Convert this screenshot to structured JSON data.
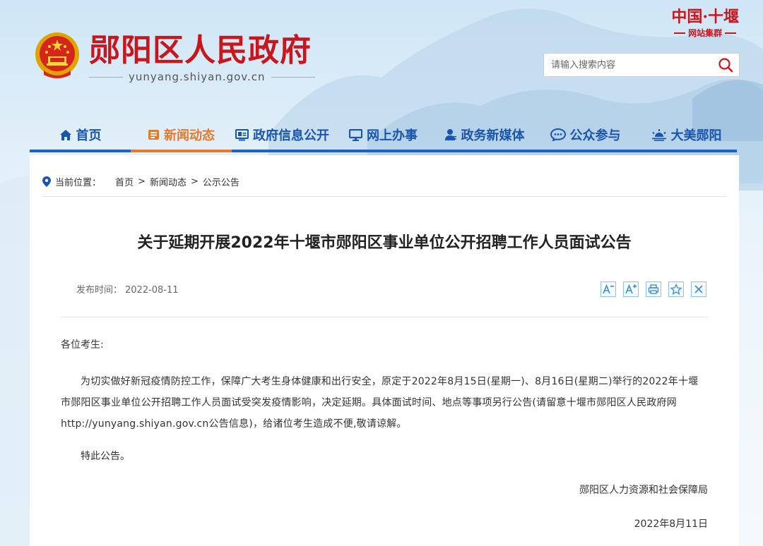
{
  "header": {
    "site_title": "郧阳区人民政府",
    "site_domain": "yunyang.shiyan.gov.cn",
    "group_logo_main": "中国·十堰",
    "group_logo_sub": "网站集群",
    "search_placeholder": "请输入搜索内容",
    "emblem_icon": "national-emblem-icon"
  },
  "nav": {
    "items": [
      {
        "label": "首页",
        "icon": "home-icon"
      },
      {
        "label": "新闻动态",
        "icon": "news-icon",
        "active": true
      },
      {
        "label": "政府信息公开",
        "icon": "info-icon"
      },
      {
        "label": "网上办事",
        "icon": "monitor-icon"
      },
      {
        "label": "政务新媒体",
        "icon": "media-icon"
      },
      {
        "label": "公众参与",
        "icon": "chat-icon"
      },
      {
        "label": "大美郧阳",
        "icon": "sunrise-icon"
      }
    ]
  },
  "breadcrumb": {
    "label": "当前位置：",
    "items": [
      "首页",
      "新闻动态",
      "公示公告"
    ],
    "separator": ">"
  },
  "article": {
    "title": "关于延期开展2022年十堰市郧阳区事业单位公开招聘工作人员面试公告",
    "publish_label": "发布时间：",
    "publish_date": "2022-08-11",
    "tools": [
      "A-",
      "A+",
      "print",
      "star",
      "close"
    ],
    "greeting": "各位考生:",
    "paragraph": "为切实做好新冠疫情防控工作，保障广大考生身体健康和出行安全，原定于2022年8月15日(星期一)、8月16日(星期二)举行的2022年十堰市郧阳区事业单位公开招聘工作人员面试受突发疫情影响，决定延期。具体面试时间、地点等事项另行公告(请留意十堰市郧阳区人民政府网http://yunyang.shiyan.gov.cn公告信息)，给诸位考生造成不便,敬请谅解。",
    "closing": "特此公告。",
    "signer": "郧阳区人力资源和社会保障局",
    "date": "2022年8月11日"
  },
  "colors": {
    "brand_red": "#c8161d",
    "nav_blue": "#1a55ad",
    "active_orange": "#e37a2d"
  }
}
